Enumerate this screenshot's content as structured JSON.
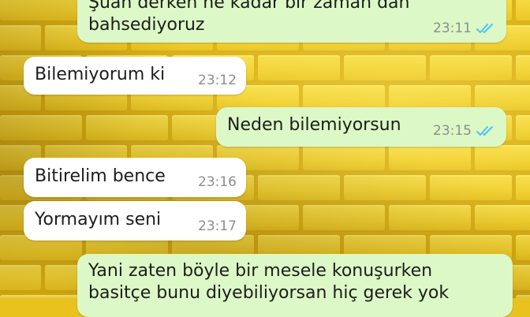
{
  "colors": {
    "incoming_bubble": "#ffffff",
    "outgoing_bubble": "#dcf8c6",
    "timestamp": "#8a8f8c",
    "read_ticks": "#4fc3f7",
    "wall": "#f1cf2e"
  },
  "messages": [
    {
      "id": "m1",
      "direction": "outgoing",
      "lines": [
        "Şuan derken ne kadar bir zaman dan",
        "bahsediyoruz"
      ],
      "time": "23:11",
      "status": "read",
      "status_icon": "double-check-icon"
    },
    {
      "id": "m2",
      "direction": "incoming",
      "lines": [
        "Bilemiyorum ki"
      ],
      "time": "23:12"
    },
    {
      "id": "m3",
      "direction": "outgoing",
      "lines": [
        "Neden bilemiyorsun"
      ],
      "time": "23:15",
      "status": "read",
      "status_icon": "double-check-icon"
    },
    {
      "id": "m4",
      "direction": "incoming",
      "lines": [
        "Bitirelim bence"
      ],
      "time": "23:16"
    },
    {
      "id": "m5",
      "direction": "incoming",
      "lines": [
        "Yormayım seni"
      ],
      "time": "23:17"
    },
    {
      "id": "m6",
      "direction": "outgoing",
      "lines": [
        "Yani zaten böyle bir mesele konuşurken",
        "basitçe bunu diyebiliyorsan hiç gerek yok"
      ],
      "time": "",
      "status": "",
      "status_icon": ""
    }
  ]
}
